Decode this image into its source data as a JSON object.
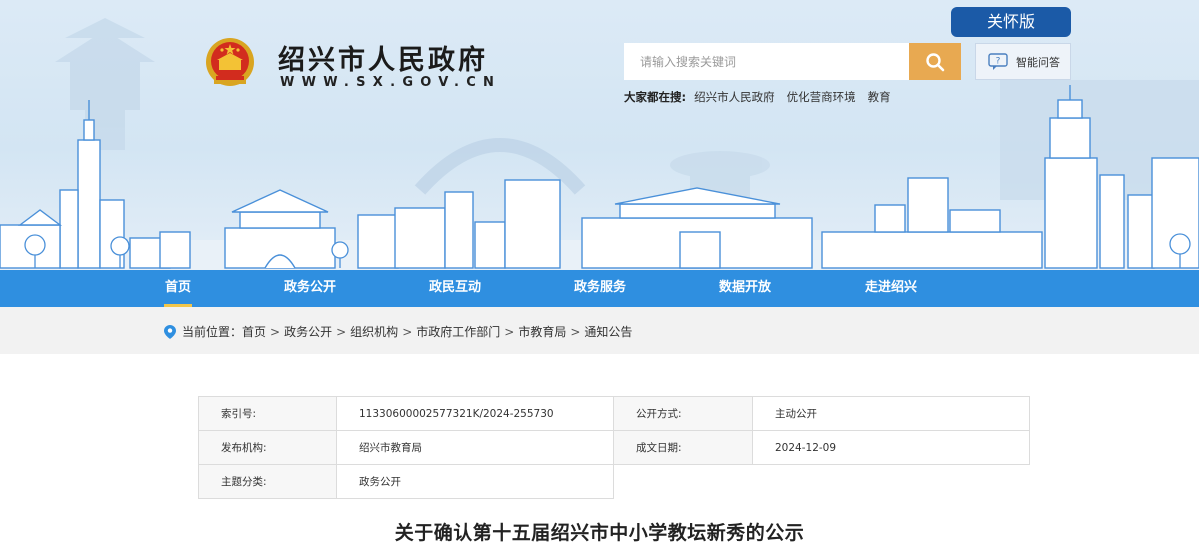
{
  "header": {
    "site_name": "绍兴市人民政府",
    "site_domain": "WWW.SX.GOV.CN",
    "care_mode_label": "关怀版",
    "search_placeholder": "请输入搜索关键词",
    "qa_label": "智能问答",
    "hot_label": "大家都在搜:",
    "hot_keywords": [
      "绍兴市人民政府",
      "优化营商环境",
      "教育"
    ]
  },
  "nav": {
    "items": [
      "首页",
      "政务公开",
      "政民互动",
      "政务服务",
      "数据开放",
      "走进绍兴"
    ],
    "active_index": 0
  },
  "breadcrumb": {
    "label": "当前位置：",
    "items": [
      "首页",
      "政务公开",
      "组织机构",
      "市政府工作部门",
      "市教育局",
      "通知公告"
    ],
    "separator": ">"
  },
  "info_table": {
    "index_label": "索引号:",
    "index_value": "11330600002577321K/2024-255730",
    "disclosure_label": "公开方式:",
    "disclosure_value": "主动公开",
    "publisher_label": "发布机构:",
    "publisher_value": "绍兴市教育局",
    "date_label": "成文日期:",
    "date_value": "2024-12-09",
    "topic_label": "主题分类:",
    "topic_value": "政务公开"
  },
  "document": {
    "title": "关于确认第十五届绍兴市中小学教坛新秀的公示"
  },
  "colors": {
    "nav_bg": "#2f8fe0",
    "care_btn": "#1b5aa7",
    "search_btn": "#e8a951",
    "active_underline": "#f2c64a"
  },
  "icons": [
    "national-emblem",
    "search-icon",
    "qa-chat-icon",
    "location-pin-icon"
  ]
}
